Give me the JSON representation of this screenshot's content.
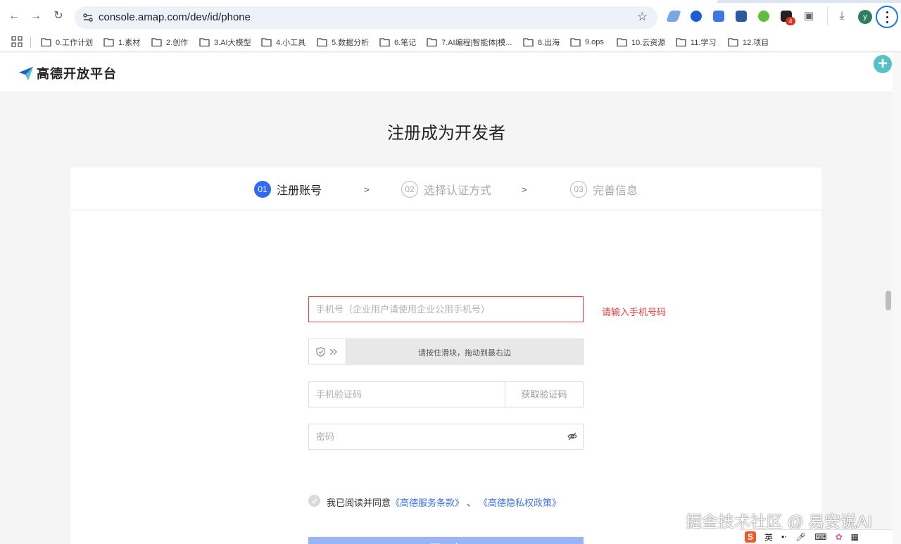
{
  "browser": {
    "url": "console.amap.com/dev/id/phone",
    "profile_initial": "y",
    "notification_badge": "4",
    "bookmarks": [
      {
        "label": "0.工作计划"
      },
      {
        "label": "1.素材"
      },
      {
        "label": "2.创作"
      },
      {
        "label": "3.AI大模型"
      },
      {
        "label": "4.小工具"
      },
      {
        "label": "5.数据分析"
      },
      {
        "label": "6.笔记"
      },
      {
        "label": "7.AI编程|智能体|模..."
      },
      {
        "label": "8.出海"
      },
      {
        "label": "9.ops"
      },
      {
        "label": "10.云资源"
      },
      {
        "label": "11.学习"
      },
      {
        "label": "12.项目"
      }
    ]
  },
  "site": {
    "logo_text": "高德开放平台",
    "page_title": "注册成为开发者"
  },
  "steps": [
    {
      "num": "01",
      "label": "注册账号"
    },
    {
      "num": "02",
      "label": "选择认证方式"
    },
    {
      "num": "03",
      "label": "完善信息"
    }
  ],
  "step_arrow": ">",
  "form": {
    "phone_placeholder": "手机号（企业用户请使用企业公用手机号）",
    "phone_error": "请输入手机号码",
    "slider_text": "请按住滑块，拖动到最右边",
    "code_placeholder": "手机验证码",
    "get_code_label": "获取验证码",
    "password_placeholder": "密码",
    "agree_text": "我已阅读并同意",
    "terms_link": "《高德服务条款》",
    "separator": "、",
    "privacy_link": "《高德隐私权政策》",
    "next_label": "下一步"
  },
  "watermark": "掘金技术社区 @ 易安说AI",
  "ime": {
    "logo": "S",
    "lang": "英"
  },
  "colors": {
    "primary": "#2f6af5",
    "error": "#e33c3c",
    "link": "#3f74e6",
    "button_disabled": "#9ab4fa"
  }
}
